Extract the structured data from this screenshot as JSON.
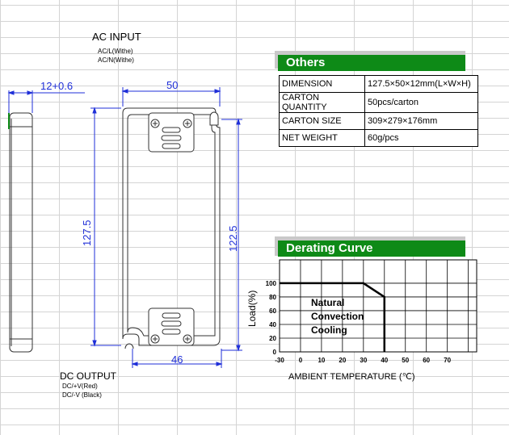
{
  "ac_input": {
    "title": "AC INPUT",
    "line1": "AC/L(Withe)",
    "line2": "AC/N(Withe)"
  },
  "dc_output": {
    "title": "DC OUTPUT",
    "line1": "DC/+V(Red)",
    "line2": "DC/-V (Black)"
  },
  "dimensions": {
    "thickness": "12+0.6",
    "width_top": "50",
    "width_bottom": "46",
    "length_outer": "127.5",
    "length_inner": "122.5"
  },
  "others": {
    "title": "Others",
    "rows": [
      {
        "key": "DIMENSION",
        "value": "127.5×50×12mm(L×W×H)"
      },
      {
        "key": "CARTON QUANTITY",
        "value": " 50pcs/carton"
      },
      {
        "key": "CARTON SIZE",
        "value": "309×279×176mm"
      },
      {
        "key": "NET WEIGHT",
        "value": "60g/pcs"
      }
    ]
  },
  "derating": {
    "title": "Derating Curve",
    "ylabel": "Load(%)",
    "xlabel": "AMBIENT TEMPERATURE (℃)",
    "note_line1": "Natural",
    "note_line2": "Convection",
    "note_line3": "Cooling"
  },
  "chart_data": {
    "type": "line",
    "title": "Derating Curve",
    "xlabel": "AMBIENT TEMPERATURE (℃)",
    "ylabel": "Load(%)",
    "x_ticks": [
      "-30",
      "0",
      "10",
      "20",
      "30",
      "40",
      "50",
      "60",
      "70"
    ],
    "y_ticks": [
      "0",
      "20",
      "40",
      "60",
      "80",
      "100"
    ],
    "series": [
      {
        "x": [
          -30,
          30,
          40,
          40
        ],
        "y": [
          100,
          100,
          80,
          0
        ]
      }
    ],
    "grid": true
  },
  "colors": {
    "header_green": "#0e8a17",
    "dimension_blue": "#1f2fd8"
  }
}
